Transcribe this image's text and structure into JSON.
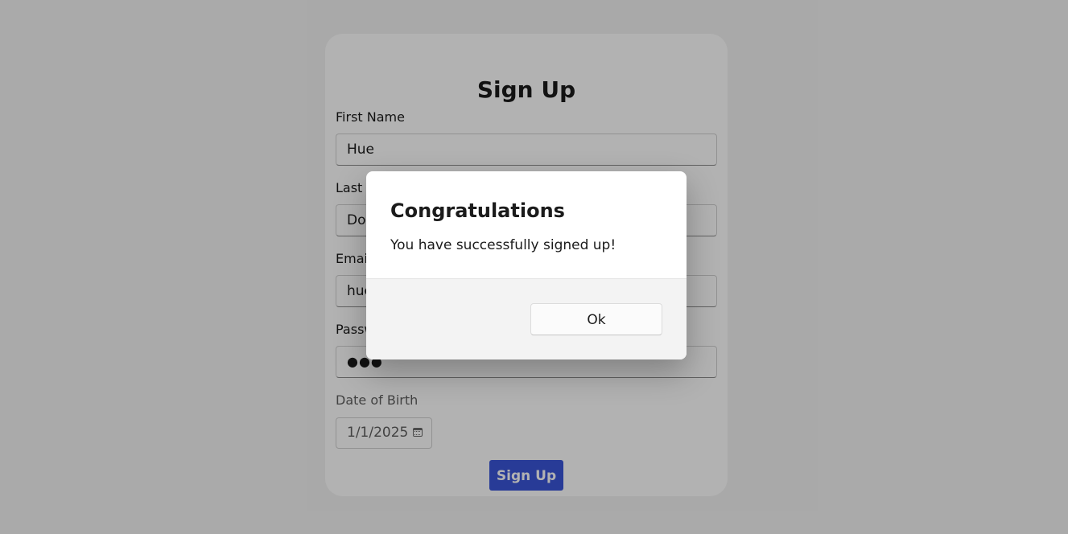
{
  "form": {
    "title": "Sign Up",
    "first_name_label": "First Name",
    "first_name_value": "Hue",
    "last_name_label": "Last Name",
    "last_name_value": "Do",
    "email_label": "Email",
    "email_value": "hue",
    "password_label": "Password",
    "password_value": "●●●",
    "dob_label": "Date of Birth",
    "dob_value": "1/1/2025",
    "submit_label": "Sign Up"
  },
  "dialog": {
    "title": "Congratulations",
    "message": "You have successfully signed up!",
    "ok_label": "Ok"
  },
  "icons": {
    "date_picker": "calendar-icon"
  },
  "colors": {
    "accent": "#3a55d8",
    "overlay": "rgba(0,0,0,0.30)"
  }
}
